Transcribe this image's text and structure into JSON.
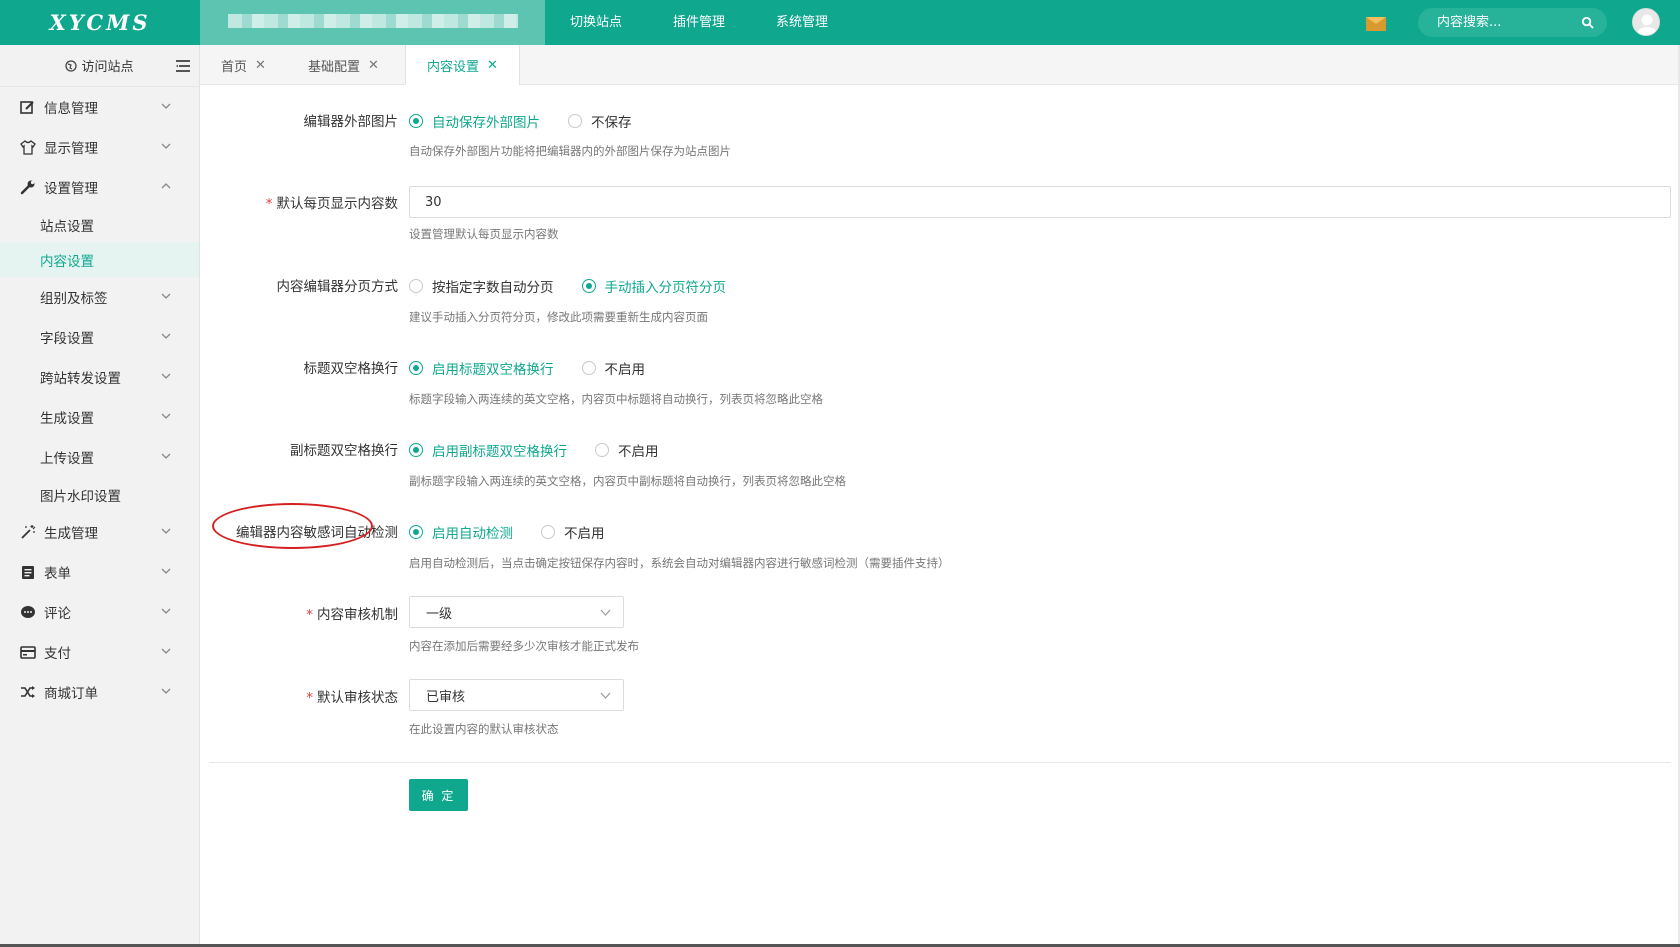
{
  "app": {
    "logo": "XYCMS"
  },
  "topnav": [
    "切换站点",
    "插件管理",
    "系统管理"
  ],
  "search": {
    "placeholder": "内容搜索..."
  },
  "sidebar": {
    "visit": "访问站点",
    "items": [
      {
        "label": "信息管理",
        "icon": "edit-icon"
      },
      {
        "label": "显示管理",
        "icon": "shirt-icon"
      },
      {
        "label": "设置管理",
        "icon": "wrench-icon",
        "expanded": true
      },
      {
        "label": "生成管理",
        "icon": "magic-wand-icon"
      },
      {
        "label": "表单",
        "icon": "form-icon"
      },
      {
        "label": "评论",
        "icon": "comment-icon"
      },
      {
        "label": "支付",
        "icon": "card-icon"
      },
      {
        "label": "商城订单",
        "icon": "shuffle-icon"
      }
    ],
    "sub": [
      "站点设置",
      "内容设置",
      "组别及标签",
      "字段设置",
      "跨站转发设置",
      "生成设置",
      "上传设置",
      "图片水印设置"
    ],
    "active_sub": "内容设置"
  },
  "tabs": [
    "首页",
    "基础配置",
    "内容设置"
  ],
  "form": {
    "f1": {
      "label": "编辑器外部图片",
      "opt1": "自动保存外部图片",
      "opt2": "不保存",
      "hint": "自动保存外部图片功能将把编辑器内的外部图片保存为站点图片"
    },
    "f2": {
      "label": "默认每页显示内容数",
      "value": "30",
      "hint": "设置管理默认每页显示内容数"
    },
    "f3": {
      "label": "内容编辑器分页方式",
      "opt1": "按指定字数自动分页",
      "opt2": "手动插入分页符分页",
      "hint": "建议手动插入分页符分页，修改此项需要重新生成内容页面"
    },
    "f4": {
      "label": "标题双空格换行",
      "opt1": "启用标题双空格换行",
      "opt2": "不启用",
      "hint": "标题字段输入两连续的英文空格，内容页中标题将自动换行，列表页将忽略此空格"
    },
    "f5": {
      "label": "副标题双空格换行",
      "opt1": "启用副标题双空格换行",
      "opt2": "不启用",
      "hint": "副标题字段输入两连续的英文空格，内容页中副标题将自动换行，列表页将忽略此空格"
    },
    "f6": {
      "label": "编辑器内容敏感词自动检测",
      "opt1": "启用自动检测",
      "opt2": "不启用",
      "hint": "启用自动检测后，当点击确定按钮保存内容时，系统会自动对编辑器内容进行敏感词检测（需要插件支持）"
    },
    "f7": {
      "label": "内容审核机制",
      "value": "一级",
      "hint": "内容在添加后需要经多少次审核才能正式发布"
    },
    "f8": {
      "label": "默认审核状态",
      "value": "已审核",
      "hint": "在此设置内容的默认审核状态"
    },
    "submit": "确 定"
  },
  "colors": {
    "primary": "#0fa88e",
    "required": "#e23b3b",
    "annotation": "#d42020"
  }
}
